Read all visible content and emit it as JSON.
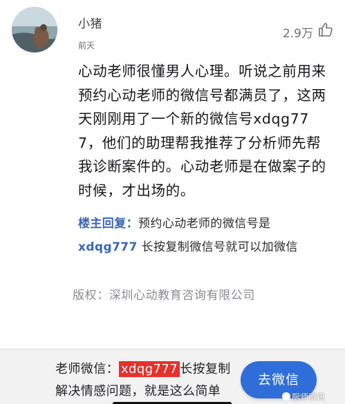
{
  "comment": {
    "username": "小猪",
    "time": "前天",
    "likes": "2.9万",
    "body": "心动老师很懂男人心理。听说之前用来预约心动老师的微信号都满员了，这两 天刚刚用了一个新的微信号xdqg777，他们的助理帮我推荐了分析师先帮我诊断案件的。心动老师是在做案子的时候，才出场的。"
  },
  "reply": {
    "tag": "楼主回复",
    "colon": "：",
    "text_before": "预约心动老师的微信号是",
    "handle": "xdqg777",
    "text_after": " 长按复制微信号就可以加微信"
  },
  "copyright": "版权：深圳心动教育咨询有限公司",
  "bottom_bar": {
    "label": "老师微信：",
    "wechat_id": "xdqg777",
    "copy_hint": "长按复制",
    "line2": "解决情感问题，就是这么简单",
    "button": "去微信",
    "watermark": "厨师资讯"
  },
  "colors": {
    "accent_blue": "#3a66b8",
    "button_blue": "#2f6ed8",
    "highlight_red": "#e8302a"
  },
  "icons": {
    "like": "thumbs-up-icon"
  }
}
